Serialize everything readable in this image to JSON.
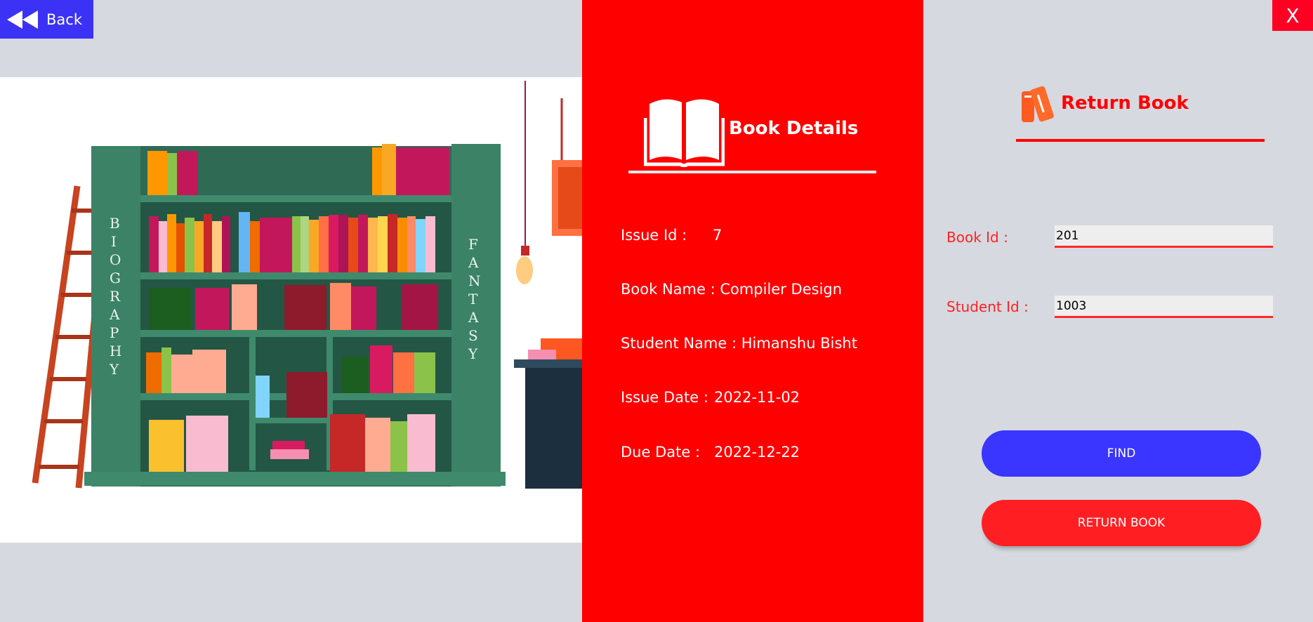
{
  "nav": {
    "back_label": "Back",
    "close_label": "X"
  },
  "illustration": {
    "left_shelf_label": "BIOGRAPHY",
    "right_shelf_label": "FANTASY"
  },
  "details": {
    "title": "Book Details",
    "rows": [
      {
        "label": "Issue Id :",
        "value": "7"
      },
      {
        "label": "Book Name :",
        "value": "Compiler Design"
      },
      {
        "label": "Student Name :",
        "value": "Himanshu Bisht"
      },
      {
        "label": "Issue Date :",
        "value": "2022-11-02"
      },
      {
        "label": "Due Date :",
        "value": "2022-12-22"
      }
    ]
  },
  "form": {
    "title": "Return Book",
    "book_id_label": "Book Id :",
    "book_id_value": "201",
    "student_id_label": "Student Id :",
    "student_id_value": "1003",
    "find_label": "FIND",
    "return_label": "RETURN BOOK"
  },
  "colors": {
    "panel_red": "#ff0000",
    "button_blue": "#3a35ff",
    "background": "#d6d9e0"
  }
}
